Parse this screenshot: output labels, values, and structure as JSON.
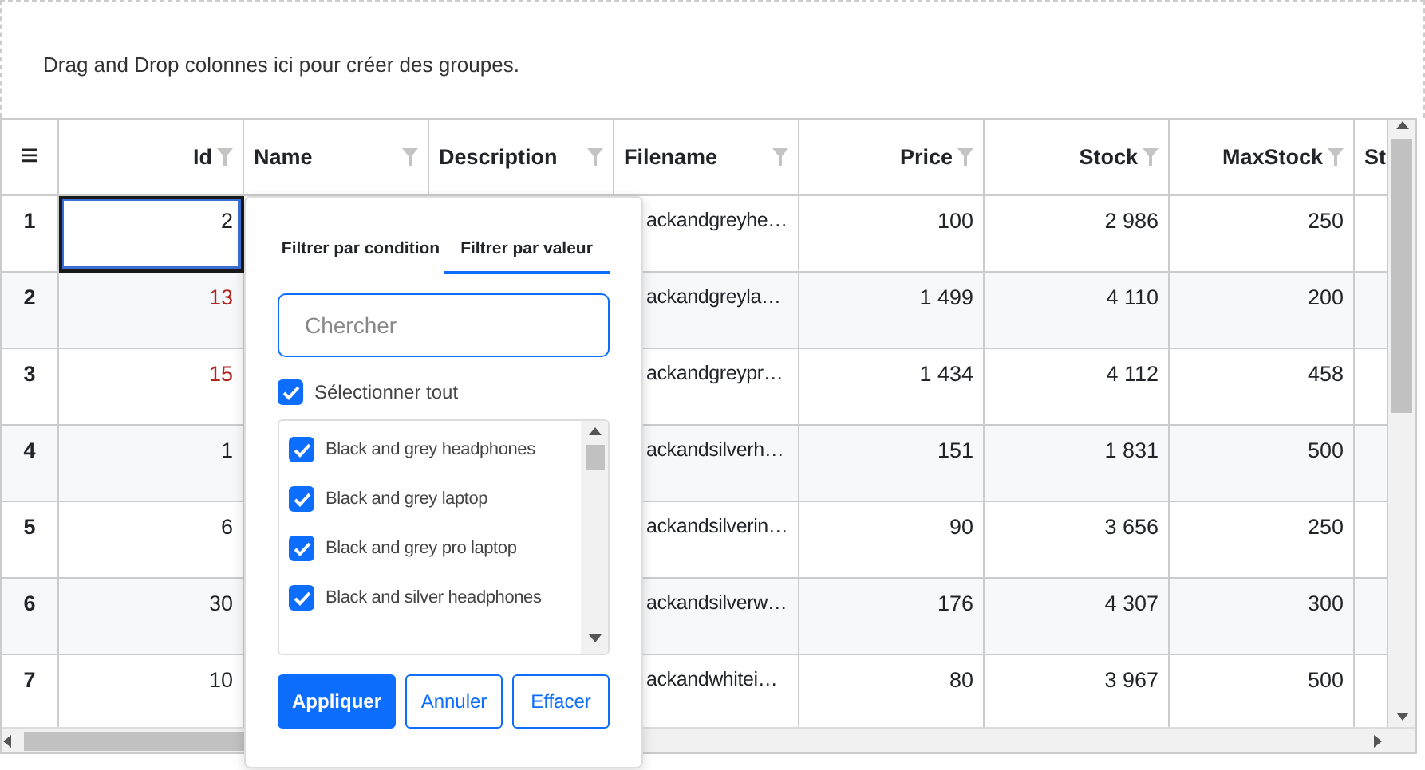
{
  "group_panel": {
    "text": "Drag and Drop colonnes ici pour créer des groupes."
  },
  "grid": {
    "menu_icon": "≡",
    "columns": [
      {
        "label": "Id",
        "kind": "numeric",
        "filter": true
      },
      {
        "label": "Name",
        "kind": "text",
        "filter": true
      },
      {
        "label": "Description",
        "kind": "text",
        "filter": true
      },
      {
        "label": "Filename",
        "kind": "text",
        "filter": true
      },
      {
        "label": "Price",
        "kind": "numeric",
        "filter": true
      },
      {
        "label": "Stock",
        "kind": "numeric",
        "filter": true
      },
      {
        "label": "MaxStock",
        "kind": "numeric",
        "filter": true
      },
      {
        "label": "St",
        "kind": "text",
        "filter": false
      }
    ],
    "rows": [
      {
        "number": "1",
        "id": "2",
        "flagged": false,
        "selected": true,
        "filename": "ackandgreyhe…",
        "price": "100",
        "stock": "2 986",
        "maxstock": "250"
      },
      {
        "number": "2",
        "id": "13",
        "flagged": true,
        "selected": false,
        "filename": "ackandgreyla…",
        "price": "1 499",
        "stock": "4 110",
        "maxstock": "200"
      },
      {
        "number": "3",
        "id": "15",
        "flagged": true,
        "selected": false,
        "filename": "ackandgreypr…",
        "price": "1 434",
        "stock": "4 112",
        "maxstock": "458"
      },
      {
        "number": "4",
        "id": "1",
        "flagged": false,
        "selected": false,
        "filename": "ackandsilverh…",
        "price": "151",
        "stock": "1 831",
        "maxstock": "500"
      },
      {
        "number": "5",
        "id": "6",
        "flagged": false,
        "selected": false,
        "filename": "ackandsilverin…",
        "price": "90",
        "stock": "3 656",
        "maxstock": "250"
      },
      {
        "number": "6",
        "id": "30",
        "flagged": false,
        "selected": false,
        "filename": "ackandsilverw…",
        "price": "176",
        "stock": "4 307",
        "maxstock": "300"
      },
      {
        "number": "7",
        "id": "10",
        "flagged": false,
        "selected": false,
        "filename": "ackandwhitei…",
        "price": "80",
        "stock": "3 967",
        "maxstock": "500"
      }
    ]
  },
  "filter_popup": {
    "tabs": [
      {
        "label": "Filtrer par condition",
        "selected": false
      },
      {
        "label": "Filtrer par valeur",
        "selected": true
      }
    ],
    "search": {
      "placeholder": "Chercher"
    },
    "select_all": {
      "label": "Sélectionner tout",
      "checked": true
    },
    "values": [
      {
        "label": "Black and grey headphones",
        "checked": true
      },
      {
        "label": "Black and grey laptop",
        "checked": true
      },
      {
        "label": "Black and grey pro laptop",
        "checked": true
      },
      {
        "label": "Black and silver headphones",
        "checked": true
      }
    ],
    "buttons": [
      {
        "label": "Appliquer",
        "kind": "primary"
      },
      {
        "label": "Annuler",
        "kind": "outline"
      },
      {
        "label": "Effacer",
        "kind": "outline"
      }
    ]
  }
}
